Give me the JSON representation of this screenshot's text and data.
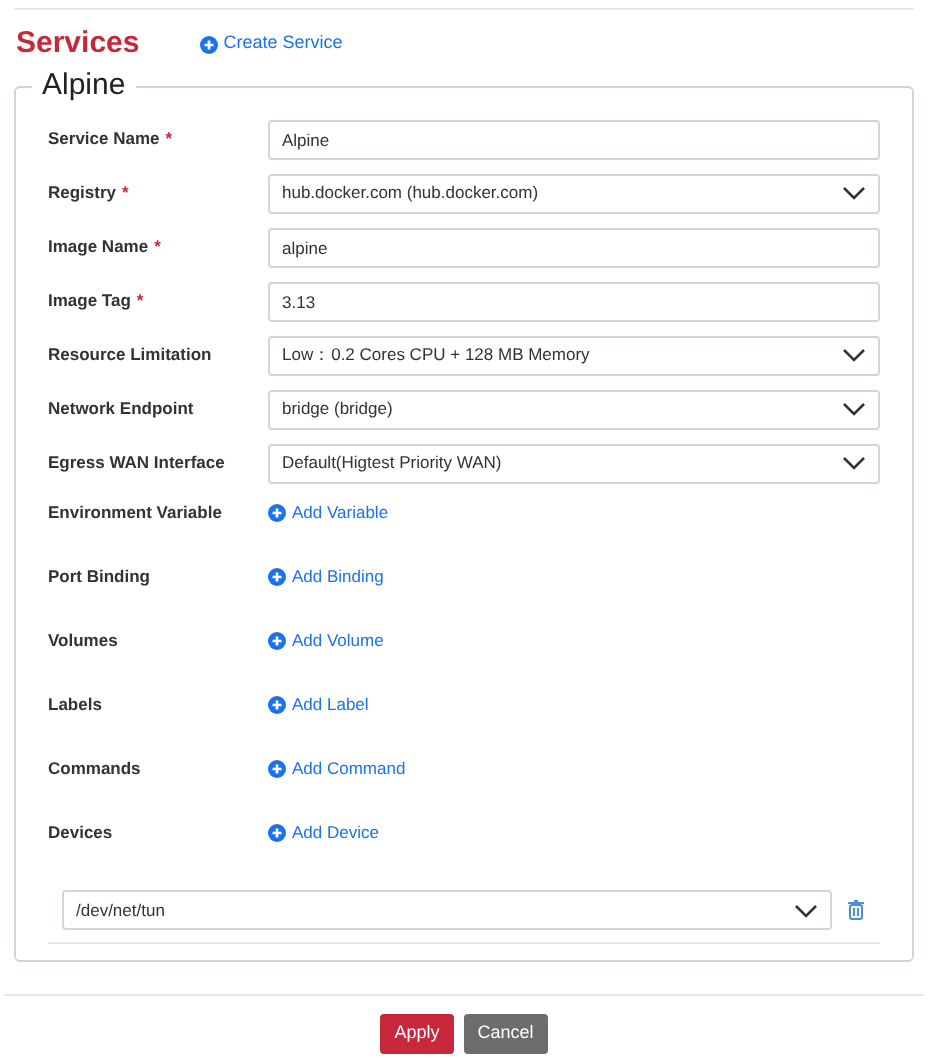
{
  "header": {
    "title": "Services",
    "create_link": "Create Service"
  },
  "service": {
    "legend": "Alpine",
    "fields": [
      {
        "kind": "text",
        "label": "Service Name",
        "required_mark": "*",
        "value": "Alpine"
      },
      {
        "kind": "select",
        "label": "Registry",
        "required_mark": "*",
        "value": "hub.docker.com (hub.docker.com)"
      },
      {
        "kind": "text",
        "label": "Image Name",
        "required_mark": "*",
        "value": "alpine"
      },
      {
        "kind": "text",
        "label": "Image Tag",
        "required_mark": "*",
        "value": "3.13"
      },
      {
        "kind": "select",
        "label": "Resource Limitation",
        "value": "Low：0.2 Cores CPU + 128 MB Memory"
      },
      {
        "kind": "select",
        "label": "Network Endpoint",
        "value": "bridge (bridge)"
      },
      {
        "kind": "select",
        "label": "Egress WAN Interface",
        "value": "Default(Higtest Priority WAN)"
      },
      {
        "kind": "add",
        "label": "Environment Variable",
        "value": "Add Variable"
      },
      {
        "kind": "add",
        "label": "Port Binding",
        "value": "Add Binding"
      },
      {
        "kind": "add",
        "label": "Volumes",
        "value": "Add Volume"
      },
      {
        "kind": "add",
        "label": "Labels",
        "value": "Add Label"
      },
      {
        "kind": "add",
        "label": "Commands",
        "value": "Add Command"
      },
      {
        "kind": "add",
        "label": "Devices",
        "value": "Add Device"
      }
    ],
    "devices": [
      {
        "value": "/dev/net/tun"
      }
    ]
  },
  "buttons": [
    {
      "kind": "primary",
      "label": "Apply"
    },
    {
      "kind": "secondary",
      "label": "Cancel"
    }
  ]
}
